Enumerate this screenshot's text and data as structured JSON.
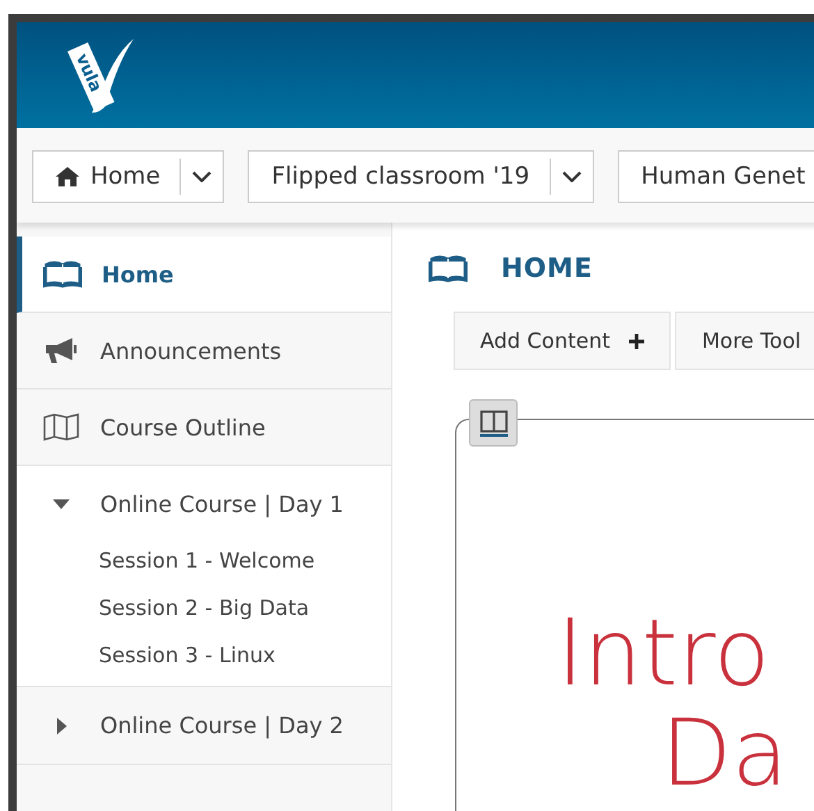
{
  "logo": {
    "text": "vula"
  },
  "nav": [
    {
      "label": "Home",
      "kind": "home",
      "dropdown": true
    },
    {
      "label": "Flipped classroom '19",
      "kind": "site",
      "dropdown": true
    },
    {
      "label": "Human Genet",
      "kind": "site",
      "dropdown": false
    }
  ],
  "sidebar": {
    "items": [
      {
        "label": "Home",
        "kind": "book",
        "selected": true
      },
      {
        "label": "Announcements",
        "kind": "megaphone",
        "selected": false
      },
      {
        "label": "Course Outline",
        "kind": "map",
        "selected": false
      },
      {
        "label": "Online Course | Day 1",
        "kind": "folder",
        "selected": false,
        "expanded": true,
        "children": [
          {
            "label": "Session 1 - Welcome"
          },
          {
            "label": "Session 2 - Big Data"
          },
          {
            "label": "Session 3 - Linux"
          }
        ]
      },
      {
        "label": "Online Course | Day 2",
        "kind": "folder",
        "selected": false,
        "expanded": false
      }
    ]
  },
  "main": {
    "title": "HOME",
    "tools": [
      {
        "label": "Add Content",
        "kind": "add"
      },
      {
        "label": "More Tool",
        "kind": "menu"
      }
    ],
    "content": {
      "lines": [
        "Intro",
        "Da"
      ]
    }
  }
}
